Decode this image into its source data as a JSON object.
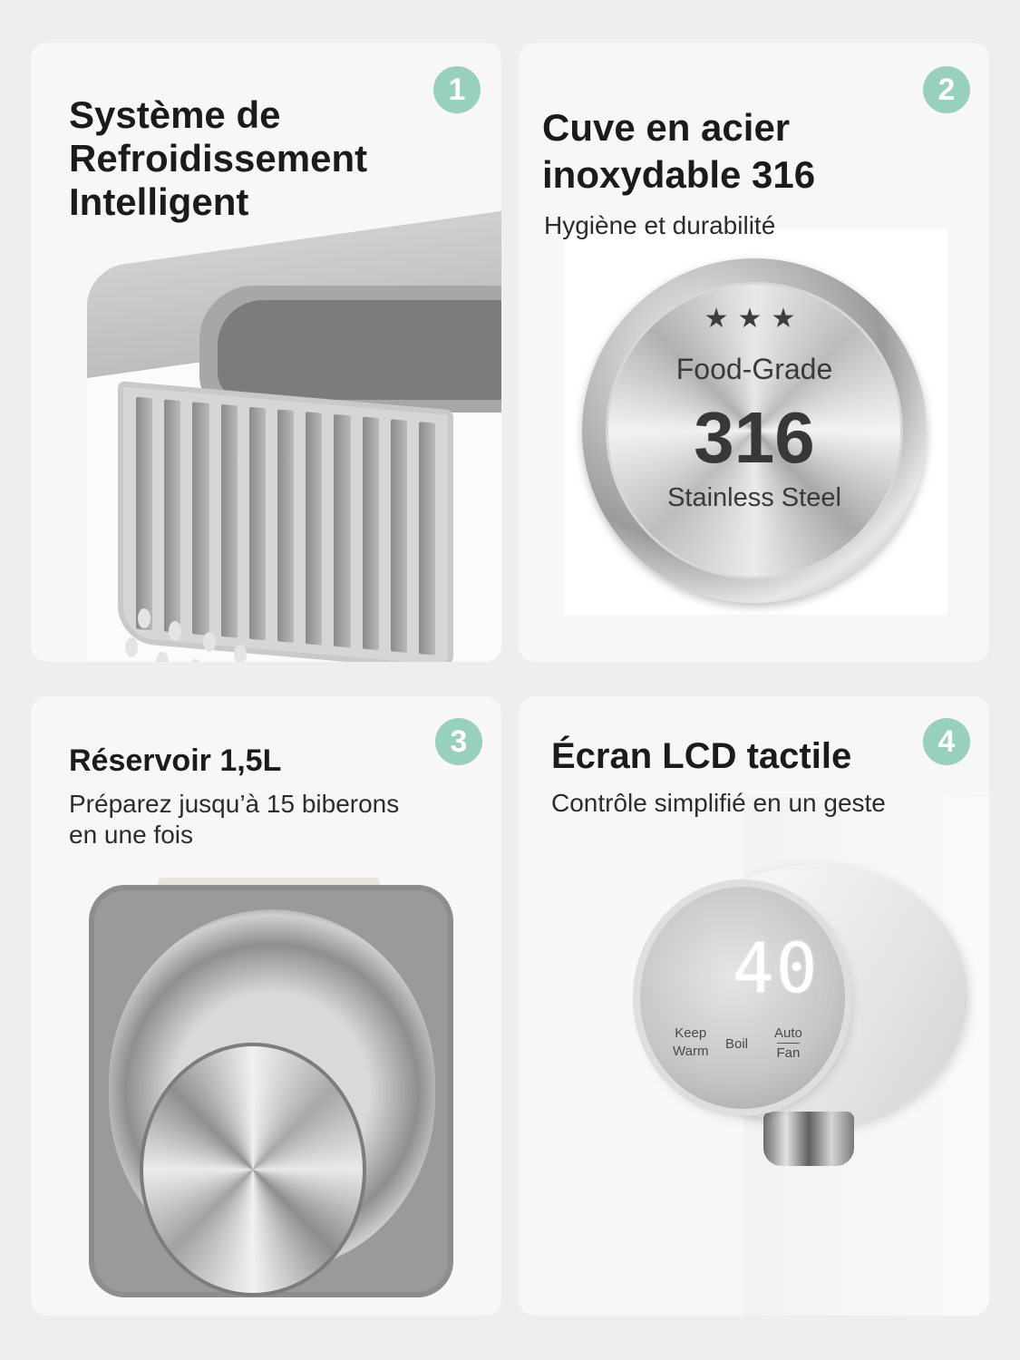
{
  "accent_color": "#98d1bb",
  "cards": [
    {
      "badge": "1",
      "title_lines": [
        "Système de",
        "Refroidissement",
        "Intelligent"
      ]
    },
    {
      "badge": "2",
      "title_lines": [
        "Cuve en acier",
        "inoxydable 316"
      ],
      "subtitle": "Hygiène et durabilité",
      "seal": {
        "stars": "★★★",
        "line1": "Food-Grade",
        "line2": "316",
        "line3": "Stainless Steel"
      }
    },
    {
      "badge": "3",
      "title": "Réservoir 1,5L",
      "subtitle_lines": [
        "Préparez jusqu’à 15 biberons",
        "en une fois"
      ]
    },
    {
      "badge": "4",
      "title": "Écran LCD tactile",
      "subtitle": "Contrôle simplifié en un geste",
      "dial": {
        "display": "40",
        "buttons": [
          {
            "line1": "Keep",
            "line2": "Warm"
          },
          {
            "line1": "Boil",
            "line2": ""
          },
          {
            "line1": "Auto",
            "line2": "Fan"
          }
        ]
      }
    }
  ]
}
